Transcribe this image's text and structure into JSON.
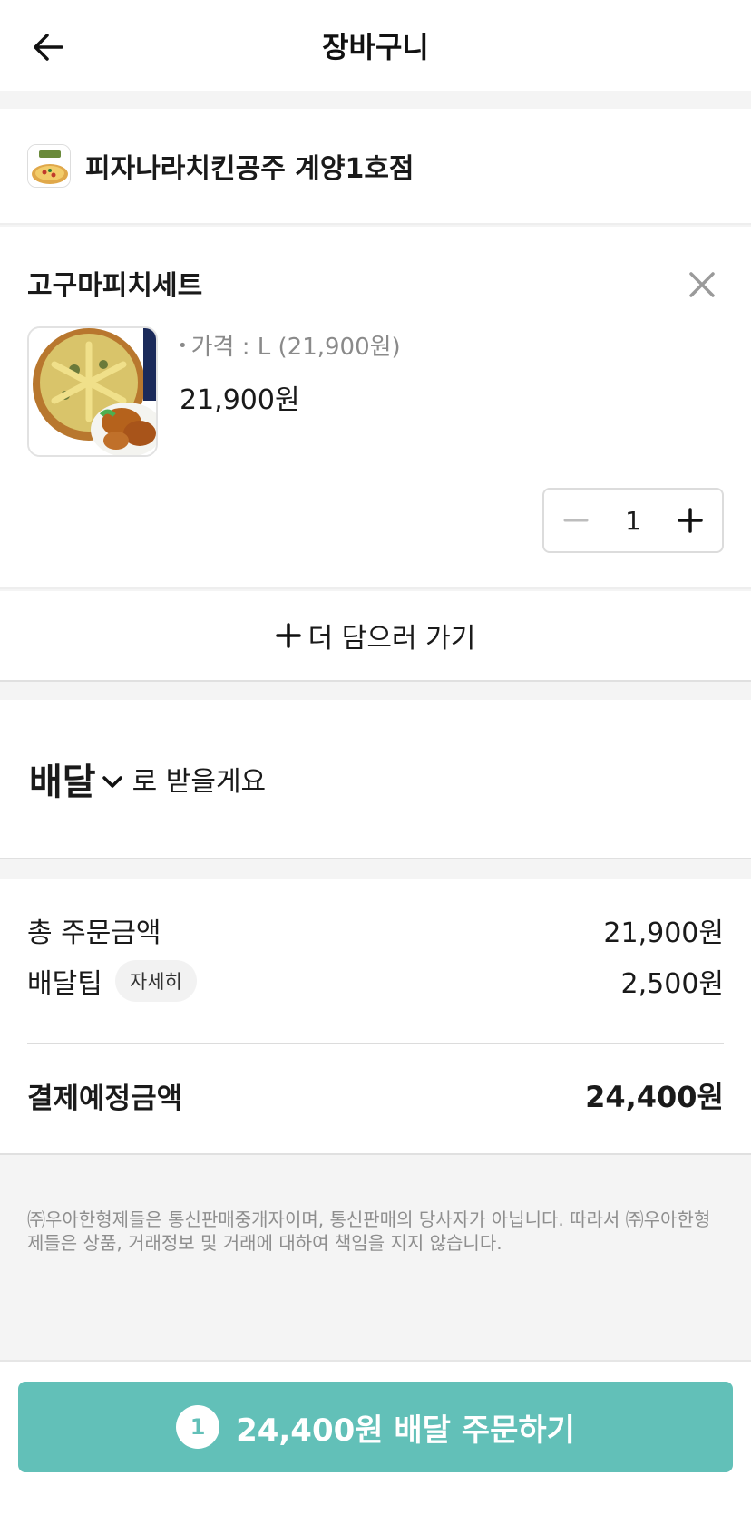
{
  "header": {
    "title": "장바구니",
    "back_icon": "arrow-left-icon"
  },
  "store": {
    "name": "피자나라치킨공주 계양1호점"
  },
  "cart_item": {
    "name": "고구마피치세트",
    "option_bullet": "•",
    "option": "가격 : L (21,900원)",
    "price": "21,900원",
    "quantity": "1",
    "remove_icon": "close-icon",
    "decrement_icon": "minus-icon",
    "increment_icon": "plus-icon"
  },
  "add_more": {
    "label": "더 담으러 가기",
    "icon": "plus-icon"
  },
  "delivery": {
    "method": "배달",
    "suffix": "로 받을게요",
    "icon": "chevron-down-icon"
  },
  "summary": {
    "order_amount_label": "총 주문금액",
    "order_amount_value": "21,900원",
    "delivery_tip_label": "배달팁",
    "delivery_tip_detail": "자세히",
    "delivery_tip_value": "2,500원",
    "total_label": "결제예정금액",
    "total_value": "24,400원"
  },
  "disclaimer": "㈜우아한형제들은 통신판매중개자이며, 통신판매의 당사자가 아닙니다. 따라서 ㈜우아한형제들은 상품, 거래정보 및 거래에 대하여 책임을 지지 않습니다.",
  "order_button": {
    "count": "1",
    "label": "24,400원 배달 주문하기"
  },
  "colors": {
    "accent": "#62c0b8",
    "background": "#f4f4f4",
    "text": "#1a1a1a",
    "muted": "#8e8e8e"
  }
}
